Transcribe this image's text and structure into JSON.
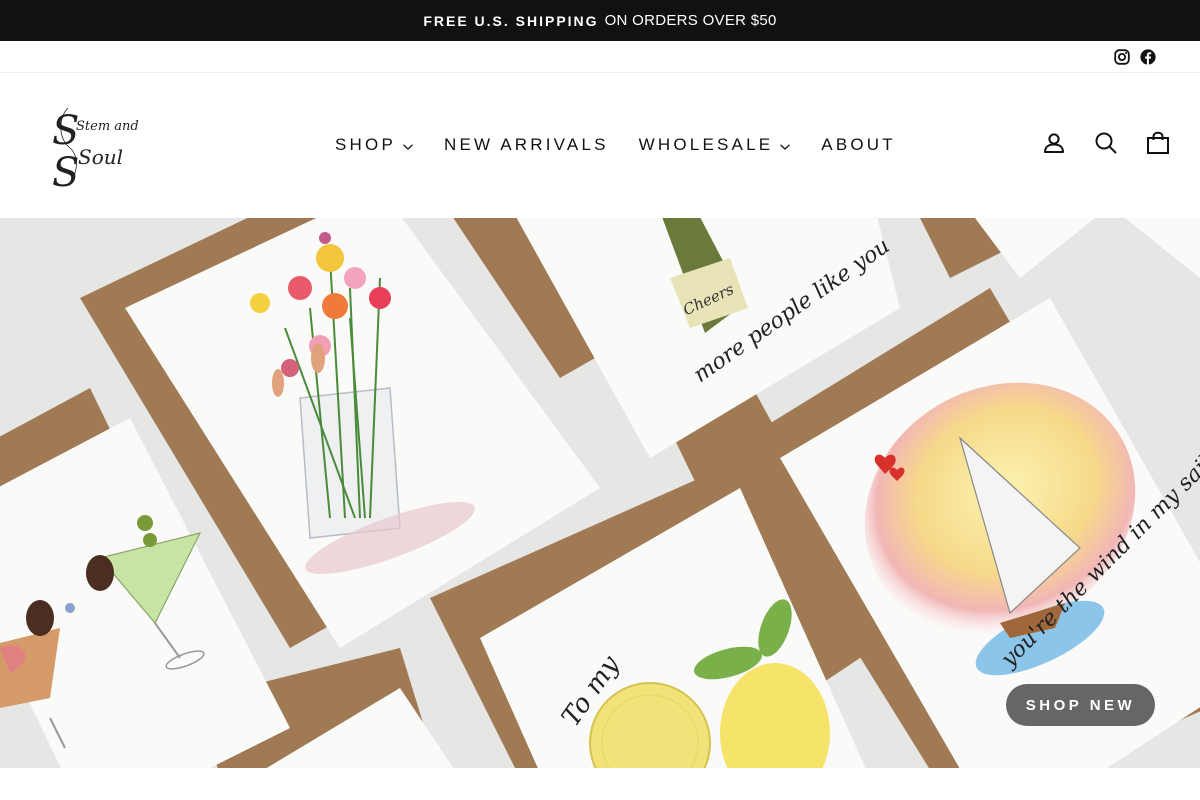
{
  "announcement": {
    "bold": "FREE U.S. SHIPPING",
    "rest": "ON ORDERS OVER $50"
  },
  "social": [
    {
      "icon": "instagram-icon"
    },
    {
      "icon": "facebook-icon"
    }
  ],
  "logo": {
    "line1": "Stem and",
    "line2": "Soul"
  },
  "nav": {
    "shop": "SHOP",
    "new_arrivals": "NEW ARRIVALS",
    "wholesale": "WHOLESALE",
    "about": "ABOUT"
  },
  "header_icons": [
    "user-icon",
    "search-icon",
    "cart-icon"
  ],
  "hero": {
    "card_texts": {
      "bottle_label": "Cheers",
      "people": "more people like you",
      "sail": "you're the wind in my sails",
      "lemon": "To my"
    },
    "cta": "SHOP NEW"
  },
  "colors": {
    "announcement_bg": "#111111",
    "kraft": "#a07a54",
    "hero_bg": "#e6e6e4",
    "cta_bg": "#3c3c3c"
  }
}
